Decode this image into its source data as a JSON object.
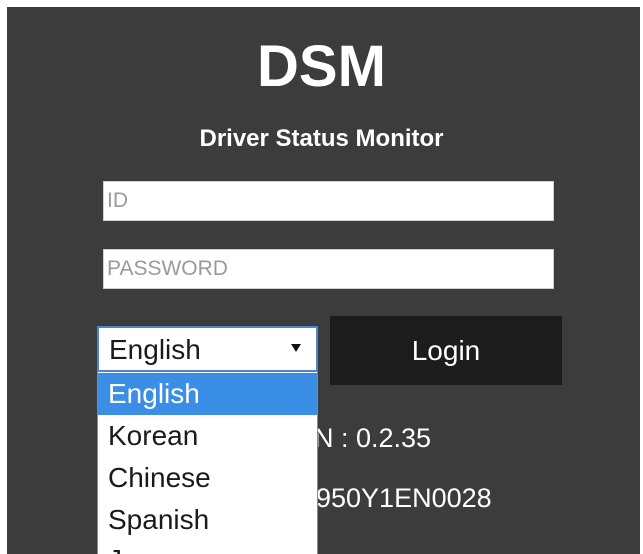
{
  "app": {
    "title": "DSM",
    "subtitle": "Driver Status Monitor"
  },
  "login_form": {
    "id_placeholder": "ID",
    "id_value": "",
    "password_placeholder": "PASSWORD",
    "password_value": "",
    "login_label": "Login"
  },
  "language": {
    "selected": "English",
    "open": true,
    "options": [
      {
        "label": "English",
        "highlighted": true
      },
      {
        "label": "Korean",
        "highlighted": false
      },
      {
        "label": "Chinese",
        "highlighted": false
      },
      {
        "label": "Spanish",
        "highlighted": false
      },
      {
        "label": "Japanese",
        "highlighted": false
      }
    ]
  },
  "info": {
    "version_text": "N : 0.2.35",
    "serial_text": "950Y1EN0028"
  },
  "colors": {
    "panel_background": "#3c3c3c",
    "login_button": "#1c1c1c",
    "dropdown_highlight": "#3a8ee6",
    "select_border": "#4d86c9",
    "text_on_dark": "#ffffff"
  }
}
